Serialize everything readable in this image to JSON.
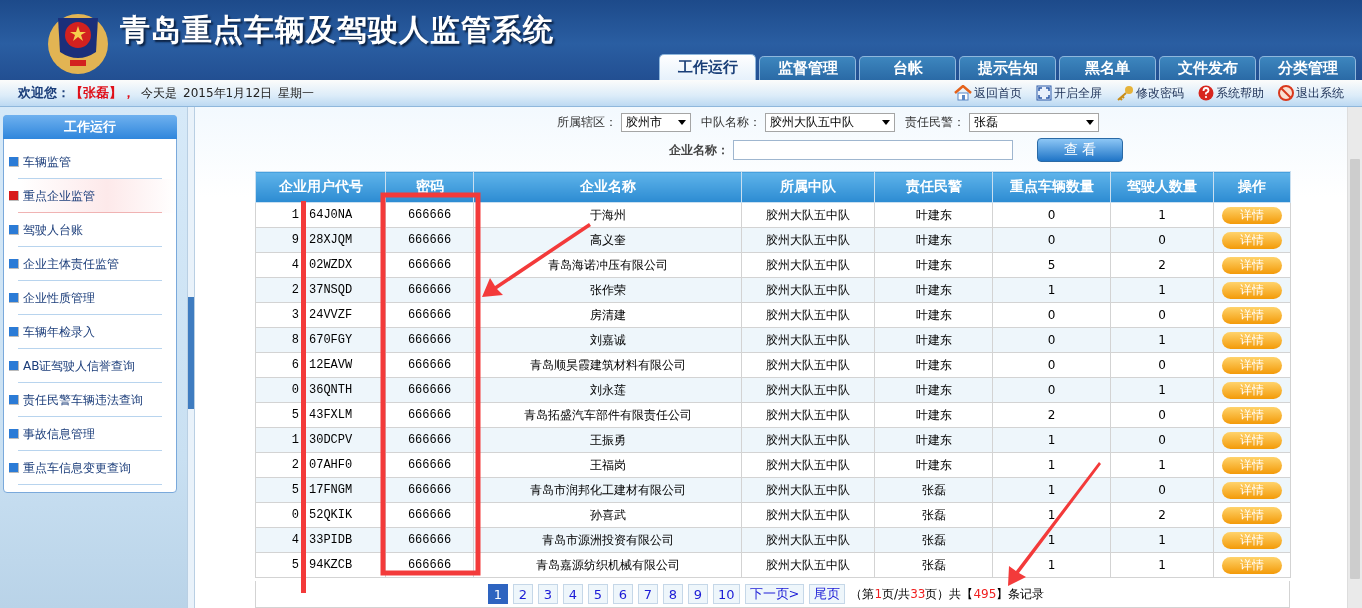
{
  "header": {
    "title": "青岛重点车辆及驾驶人监管系统"
  },
  "tabs": [
    {
      "label": "工作运行",
      "selected": true
    },
    {
      "label": "监督管理",
      "selected": false
    },
    {
      "label": "台帐",
      "selected": false
    },
    {
      "label": "提示告知",
      "selected": false
    },
    {
      "label": "黑名单",
      "selected": false
    },
    {
      "label": "文件发布",
      "selected": false
    },
    {
      "label": "分类管理",
      "selected": false
    }
  ],
  "info_bar": {
    "welcome_label": "欢迎您：",
    "user": "【张磊】，",
    "today_label": "今天是",
    "date": "2015年1月12日",
    "weekday": "星期一",
    "links": [
      {
        "kind": "home",
        "label": "返回首页"
      },
      {
        "kind": "fullscreen",
        "label": "开启全屏"
      },
      {
        "kind": "key",
        "label": "修改密码"
      },
      {
        "kind": "help",
        "label": "系统帮助"
      },
      {
        "kind": "exit",
        "label": "退出系统"
      }
    ]
  },
  "sidebar": {
    "title": "工作运行",
    "items": [
      {
        "label": "车辆监管",
        "selected": false
      },
      {
        "label": "重点企业监管",
        "selected": true
      },
      {
        "label": "驾驶人台账",
        "selected": false
      },
      {
        "label": "企业主体责任监管",
        "selected": false
      },
      {
        "label": "企业性质管理",
        "selected": false
      },
      {
        "label": "车辆年检录入",
        "selected": false
      },
      {
        "label": "AB证驾驶人信誉查询",
        "selected": false
      },
      {
        "label": "责任民警车辆违法查询",
        "selected": false
      },
      {
        "label": "事故信息管理",
        "selected": false
      },
      {
        "label": "重点车信息变更查询",
        "selected": false
      }
    ]
  },
  "filters": {
    "district_label": "所属辖区：",
    "district": "胶州市",
    "squad_label": "中队名称：",
    "squad": "胶州大队五中队",
    "officer_label": "责任民警：",
    "officer": "张磊",
    "company_label": "企业名称：",
    "search_button": "查 看"
  },
  "table": {
    "columns": [
      "企业用户代号",
      "密码",
      "企业名称",
      "所属中队",
      "责任民警",
      "重点车辆数量",
      "驾驶人数量",
      "操作"
    ],
    "rows": [
      {
        "code_start": "1",
        "code_end": "64J0NA",
        "password": "666666",
        "company": "于海州",
        "squad": "胶州大队五中队",
        "officer": "叶建东",
        "vehicles": "0",
        "drivers": "1",
        "action": "详情"
      },
      {
        "code_start": "9",
        "code_end": "28XJQM",
        "password": "666666",
        "company": "高义奎",
        "squad": "胶州大队五中队",
        "officer": "叶建东",
        "vehicles": "0",
        "drivers": "0",
        "action": "详情"
      },
      {
        "code_start": "4",
        "code_end": "02WZDX",
        "password": "666666",
        "company": "青岛海诺冲压有限公司",
        "squad": "胶州大队五中队",
        "officer": "叶建东",
        "vehicles": "5",
        "drivers": "2",
        "action": "详情"
      },
      {
        "code_start": "2",
        "code_end": "37NSQD",
        "password": "666666",
        "company": "张作荣",
        "squad": "胶州大队五中队",
        "officer": "叶建东",
        "vehicles": "1",
        "drivers": "1",
        "action": "详情"
      },
      {
        "code_start": "3",
        "code_end": "24VVZF",
        "password": "666666",
        "company": "房清建",
        "squad": "胶州大队五中队",
        "officer": "叶建东",
        "vehicles": "0",
        "drivers": "0",
        "action": "详情"
      },
      {
        "code_start": "8",
        "code_end": "670FGY",
        "password": "666666",
        "company": "刘嘉诚",
        "squad": "胶州大队五中队",
        "officer": "叶建东",
        "vehicles": "0",
        "drivers": "1",
        "action": "详情"
      },
      {
        "code_start": "6",
        "code_end": "12EAVW",
        "password": "666666",
        "company": "青岛顺昊霞建筑材料有限公司",
        "squad": "胶州大队五中队",
        "officer": "叶建东",
        "vehicles": "0",
        "drivers": "0",
        "action": "详情"
      },
      {
        "code_start": "0",
        "code_end": "36QNTH",
        "password": "666666",
        "company": "刘永莲",
        "squad": "胶州大队五中队",
        "officer": "叶建东",
        "vehicles": "0",
        "drivers": "1",
        "action": "详情"
      },
      {
        "code_start": "5",
        "code_end": "43FXLM",
        "password": "666666",
        "company": "青岛拓盛汽车部件有限责任公司",
        "squad": "胶州大队五中队",
        "officer": "叶建东",
        "vehicles": "2",
        "drivers": "0",
        "action": "详情"
      },
      {
        "code_start": "1",
        "code_end": "30DCPV",
        "password": "666666",
        "company": "王振勇",
        "squad": "胶州大队五中队",
        "officer": "叶建东",
        "vehicles": "1",
        "drivers": "0",
        "action": "详情"
      },
      {
        "code_start": "2",
        "code_end": "07AHF0",
        "password": "666666",
        "company": "王福岗",
        "squad": "胶州大队五中队",
        "officer": "叶建东",
        "vehicles": "1",
        "drivers": "1",
        "action": "详情"
      },
      {
        "code_start": "5",
        "code_end": "17FNGM",
        "password": "666666",
        "company": "青岛市润邦化工建材有限公司",
        "squad": "胶州大队五中队",
        "officer": "张磊",
        "vehicles": "1",
        "drivers": "0",
        "action": "详情"
      },
      {
        "code_start": "0",
        "code_end": "52QKIK",
        "password": "666666",
        "company": "孙喜武",
        "squad": "胶州大队五中队",
        "officer": "张磊",
        "vehicles": "1",
        "drivers": "2",
        "action": "详情"
      },
      {
        "code_start": "4",
        "code_end": "33PIDB",
        "password": "666666",
        "company": "青岛市源洲投资有限公司",
        "squad": "胶州大队五中队",
        "officer": "张磊",
        "vehicles": "1",
        "drivers": "1",
        "action": "详情"
      },
      {
        "code_start": "5",
        "code_end": "94KZCB",
        "password": "666666",
        "company": "青岛嘉源纺织机械有限公司",
        "squad": "胶州大队五中队",
        "officer": "张磊",
        "vehicles": "1",
        "drivers": "1",
        "action": "详情"
      }
    ]
  },
  "pager": {
    "pages": [
      {
        "label": "1",
        "selected": true
      },
      {
        "label": "2",
        "selected": false
      },
      {
        "label": "3",
        "selected": false
      },
      {
        "label": "4",
        "selected": false
      },
      {
        "label": "5",
        "selected": false
      },
      {
        "label": "6",
        "selected": false
      },
      {
        "label": "7",
        "selected": false
      },
      {
        "label": "8",
        "selected": false
      },
      {
        "label": "9",
        "selected": false
      },
      {
        "label": "10",
        "selected": false
      }
    ],
    "next": "下一页>",
    "last": "尾页",
    "summary": [
      {
        "text": "（第",
        "highlight": false
      },
      {
        "text": "1",
        "highlight": true
      },
      {
        "text": "页/共",
        "highlight": false
      },
      {
        "text": "33",
        "highlight": true
      },
      {
        "text": "页）共【",
        "highlight": false
      },
      {
        "text": "495",
        "highlight": true
      },
      {
        "text": "】条记录",
        "highlight": false
      }
    ]
  },
  "annotations": [
    {
      "kind": "redaction-bar"
    },
    {
      "kind": "highlight-box"
    },
    {
      "kind": "arrow-a"
    },
    {
      "kind": "arrow-b"
    }
  ]
}
